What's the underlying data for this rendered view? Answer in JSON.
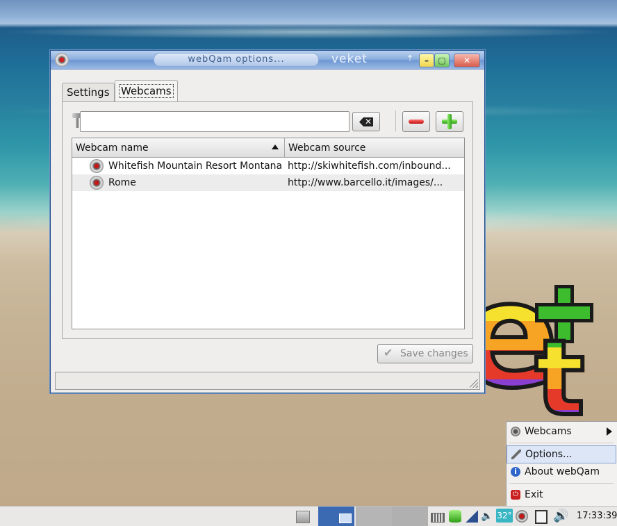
{
  "window": {
    "title": "webQam options...",
    "host": "veket",
    "tabs": [
      {
        "label": "Settings",
        "active": false
      },
      {
        "label": "Webcams",
        "active": true
      }
    ],
    "search": {
      "value": "",
      "placeholder": ""
    },
    "list": {
      "columns": [
        "Webcam name",
        "Webcam source"
      ],
      "sort": "ascending",
      "rows": [
        {
          "name": "Whitefish Mountain Resort Montana",
          "source": "http://skiwhitefish.com/inbound..."
        },
        {
          "name": "Rome",
          "source": "http://www.barcello.it/images/..."
        }
      ]
    },
    "save_label": "Save changes"
  },
  "menu": {
    "items": [
      {
        "label": "Webcams",
        "icon": "webcam-icon",
        "submenu": true
      },
      {
        "label": "Options...",
        "icon": "tools-icon",
        "highlighted": true
      },
      {
        "label": "About webQam",
        "icon": "info-icon"
      },
      {
        "label": "Exit",
        "icon": "exit-icon"
      }
    ]
  },
  "taskbar": {
    "temperature": "32°",
    "clock": "17:33:39"
  },
  "colors": {
    "accent": "#3b69b2",
    "menu_highlight": "#dce6f7",
    "temp_badge": "#38b6c4"
  }
}
